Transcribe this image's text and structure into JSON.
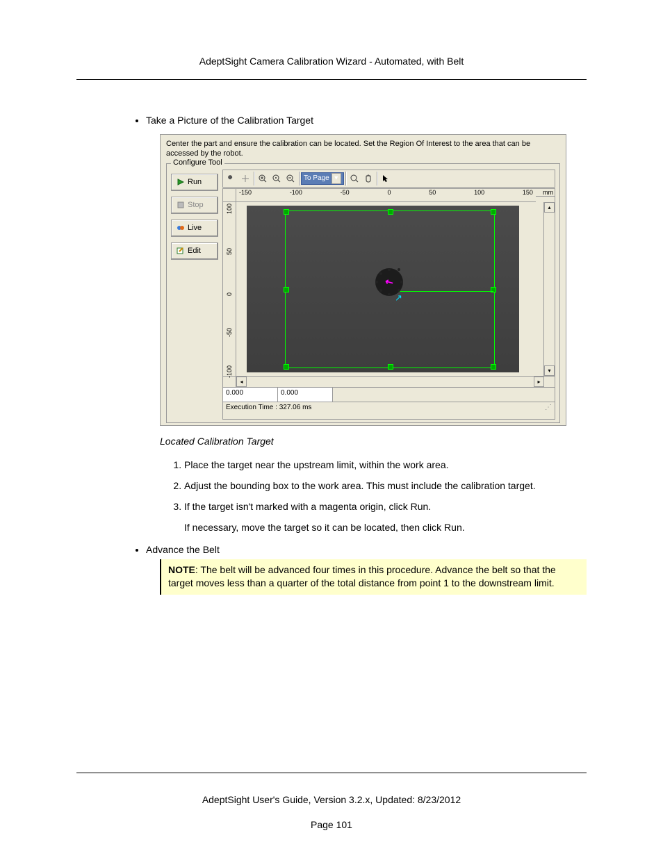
{
  "header": {
    "title": "AdeptSight Camera Calibration Wizard - Automated, with Belt"
  },
  "sections": {
    "take_picture": {
      "bullet_label": "Take a Picture of the Calibration Target"
    },
    "advance_belt": {
      "bullet_label": "Advance the Belt"
    }
  },
  "screenshot": {
    "instruction_text": "Center the part and ensure the calibration can be located. Set the Region Of Interest to the area that can be accessed by the robot.",
    "fieldset_label": "Configure Tool",
    "buttons": {
      "run": "Run",
      "stop": "Stop",
      "live": "Live",
      "edit": "Edit"
    },
    "toolbar": {
      "topage": "To Page"
    },
    "ruler": {
      "unit": "mm",
      "h_ticks": [
        "-150",
        "-100",
        "-50",
        "0",
        "50",
        "100",
        "150"
      ],
      "v_ticks": [
        "100",
        "50",
        "0",
        "-50",
        "-100"
      ]
    },
    "status": {
      "val1": "0.000",
      "val2": "0.000"
    },
    "execution": "Execution Time : 327.06 ms"
  },
  "caption": "Located Calibration Target",
  "steps": {
    "s1": "Place the target near the upstream limit, within the work area.",
    "s2": "Adjust the bounding box to the work area. This must include the calibration target.",
    "s3": "If the target isn't marked with a magenta origin, click Run.",
    "s3b": "If necessary, move the target so it can be located, then click Run."
  },
  "note": {
    "label": "NOTE",
    "text": ": The belt will be advanced four times in this procedure. Advance the belt so that the target moves less than a quarter of the total distance from point 1 to the downstream limit."
  },
  "footer": {
    "line": "AdeptSight User's Guide,  Version 3.2.x, Updated: 8/23/2012",
    "page": "Page 101"
  }
}
